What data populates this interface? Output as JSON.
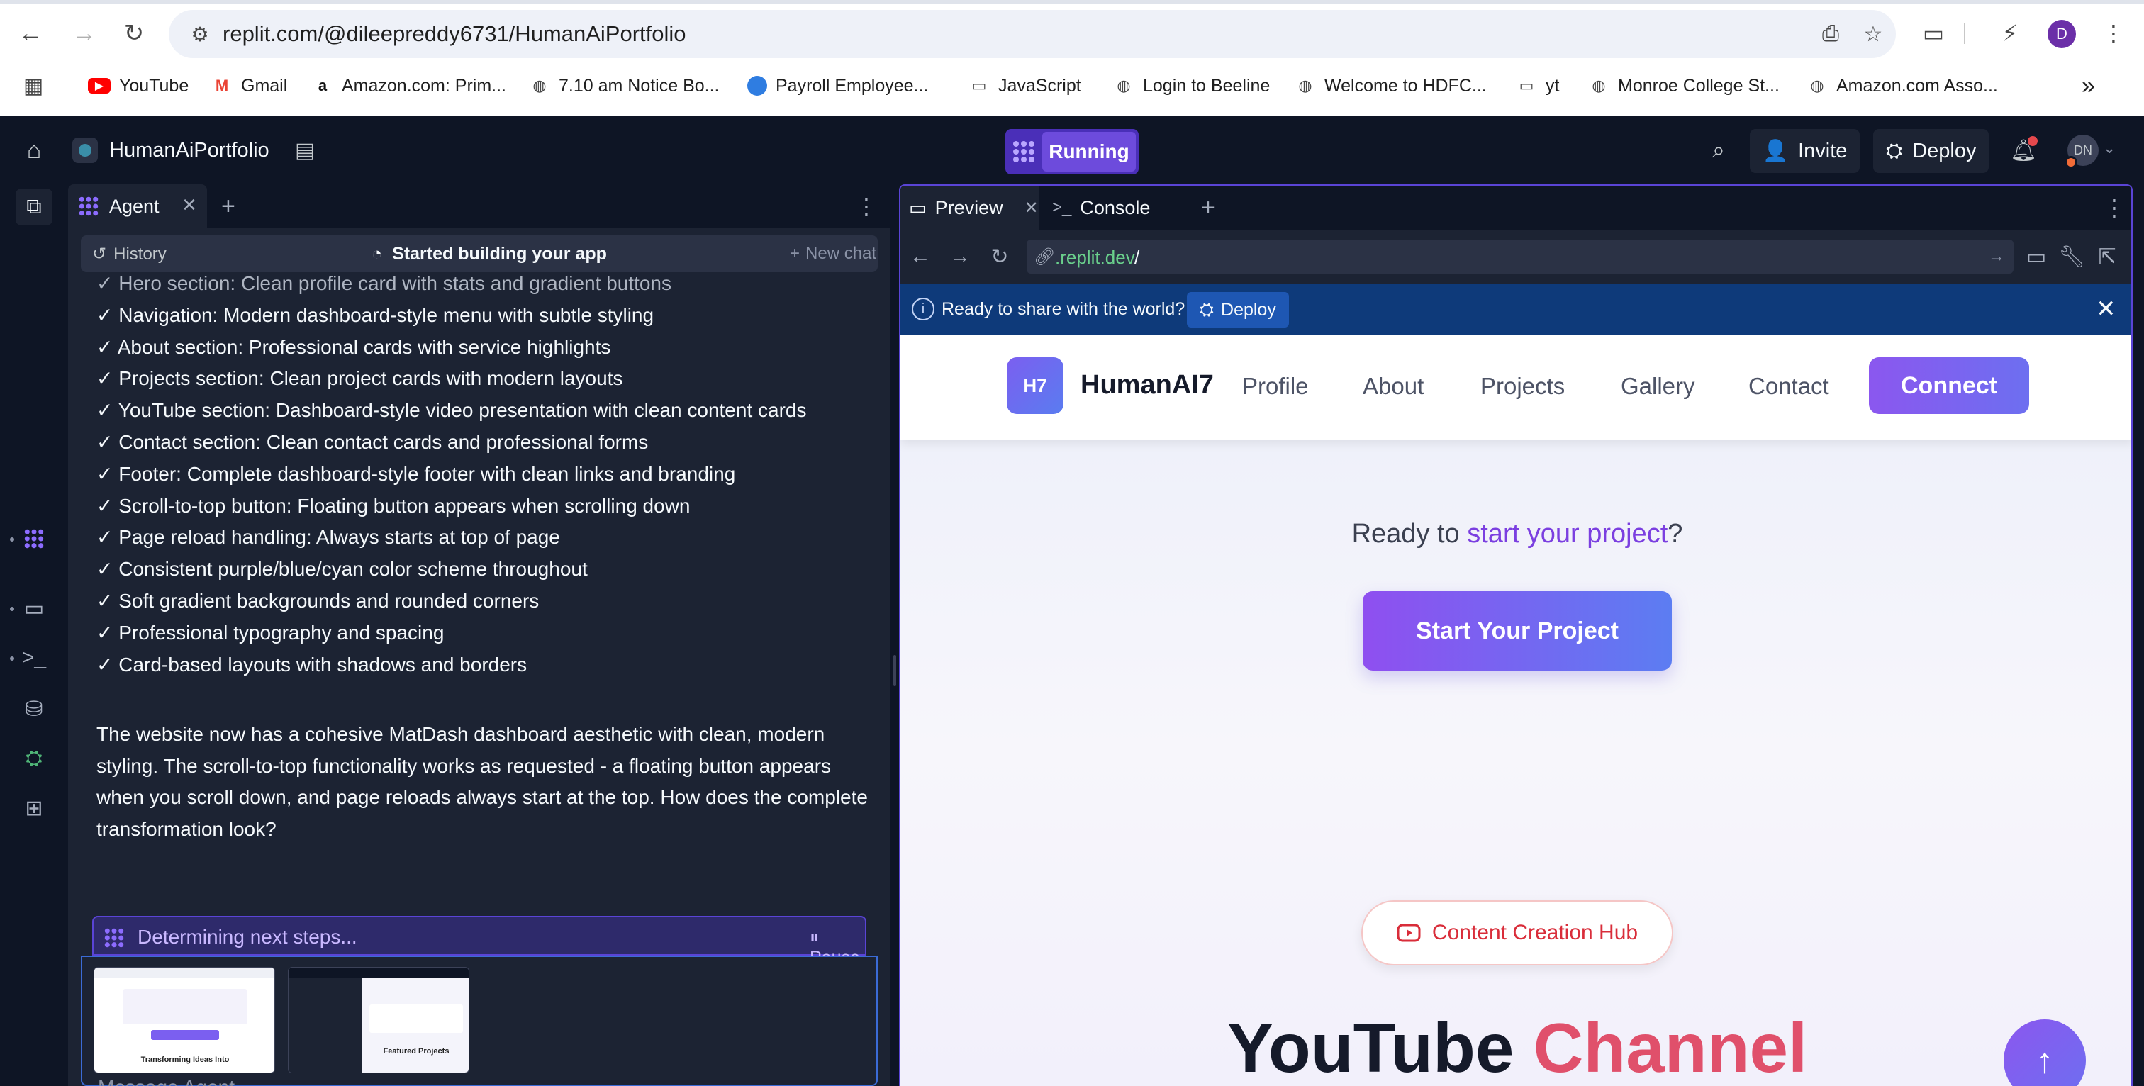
{
  "browser": {
    "url": "replit.com/@dileepreddy6731/HumanAiPortfolio",
    "profile_initial": "D",
    "bookmarks": [
      {
        "label": "YouTube",
        "icon": "youtube-icon"
      },
      {
        "label": "Gmail",
        "icon": "gmail-icon"
      },
      {
        "label": "Amazon.com: Prim...",
        "icon": "amazon-icon"
      },
      {
        "label": "7.10 am Notice Bo...",
        "icon": "globe-icon"
      },
      {
        "label": "Payroll Employee...",
        "icon": "payroll-icon"
      },
      {
        "label": "JavaScript",
        "icon": "folder-icon"
      },
      {
        "label": "Login to Beeline",
        "icon": "globe-icon"
      },
      {
        "label": "Welcome to HDFC...",
        "icon": "globe-icon"
      },
      {
        "label": "yt",
        "icon": "folder-icon"
      },
      {
        "label": "Monroe College St...",
        "icon": "globe-icon"
      },
      {
        "label": "Amazon.com Asso...",
        "icon": "globe-icon"
      }
    ],
    "more_bookmarks": "»"
  },
  "replit": {
    "repl_name": "HumanAiPortfolio",
    "run_status": "Running",
    "invite_label": "Invite",
    "deploy_label": "Deploy",
    "avatar_initials": "DN"
  },
  "agent": {
    "tab_label": "Agent",
    "history_label": "History",
    "status_title": "Started building your app",
    "new_chat_label": "New chat",
    "checklist": [
      "✓ Hero section: Clean profile card with stats and gradient buttons",
      "✓ Navigation: Modern dashboard-style menu with subtle styling",
      "✓ About section: Professional cards with service highlights",
      "✓ Projects section: Clean project cards with modern layouts",
      "✓ YouTube section: Dashboard-style video presentation with clean content cards",
      "✓ Contact section: Clean contact cards and professional forms",
      "✓ Footer: Complete dashboard-style footer with clean links and branding",
      "✓ Scroll-to-top button: Floating button appears when scrolling down",
      "✓ Page reload handling: Always starts at top of page",
      "✓ Consistent purple/blue/cyan color scheme throughout",
      "✓ Soft gradient backgrounds and rounded corners",
      "✓ Professional typography and spacing",
      "✓ Card-based layouts with shadows and borders"
    ],
    "summary": "The website now has a cohesive MatDash dashboard aesthetic with clean, modern styling. The scroll-to-top functionality works as requested - a floating button appears when you scroll down, and page reloads always start at the top. How does the complete transformation look?",
    "working_status": "Determining next steps...",
    "pause_label": "Pause",
    "attachments": [
      {
        "caption": "Transforming Ideas Into"
      },
      {
        "caption": "Featured Projects"
      }
    ],
    "input_placeholder": "Message Agent..."
  },
  "preview": {
    "tab_preview": "Preview",
    "tab_console": "Console",
    "url_domain": ".replit.dev",
    "url_path": "/",
    "banner_text": "Ready to share with the world?",
    "banner_deploy": "Deploy"
  },
  "site": {
    "logo_text": "H7",
    "brand": "HumanAI7",
    "nav": [
      "Profile",
      "About",
      "Projects",
      "Gallery",
      "Contact"
    ],
    "connect": "Connect",
    "ready_prefix": "Ready to ",
    "ready_highlight": "start your project",
    "ready_suffix": "?",
    "start_button": "Start Your Project",
    "hub_label": "Content Creation Hub",
    "heading_part1": "YouTube ",
    "heading_part2": "Channel"
  },
  "colors": {
    "replit_bg": "#0e1525",
    "panel_bg": "#1c2333",
    "accent_purple": "#6d4bdc",
    "site_gradient_start": "#8b57ef",
    "site_gradient_end": "#5c7df2",
    "heading_red": "#e0506b"
  }
}
